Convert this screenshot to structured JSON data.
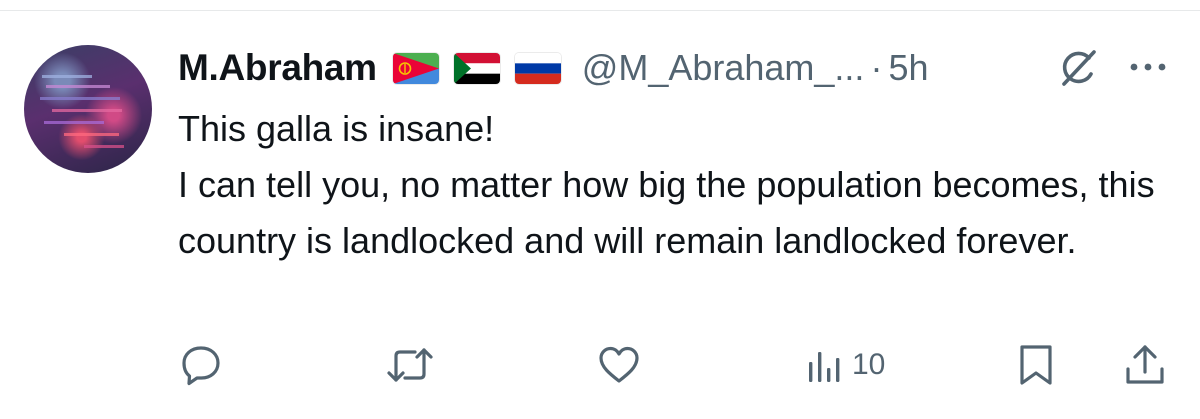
{
  "tweet": {
    "display_name": "M.Abraham",
    "handle": "@M_Abraham_...",
    "separator": "·",
    "time": "5h",
    "flags": [
      "eritrea-flag-icon",
      "sudan-flag-icon",
      "russia-flag-icon"
    ],
    "text_lines": [
      "This galla is insane!",
      "I can tell you, no matter how big the population becomes, this country is landlocked and will remain landlocked forever."
    ]
  },
  "actions": {
    "reply_icon": "reply-icon",
    "retweet_icon": "retweet-icon",
    "like_icon": "heart-icon",
    "views_icon": "views-bar-chart-icon",
    "views_count": "10",
    "bookmark_icon": "bookmark-icon",
    "share_icon": "share-icon"
  },
  "colors": {
    "text": "#0f1419",
    "secondary": "#536471",
    "divider": "#e7e9ea"
  }
}
